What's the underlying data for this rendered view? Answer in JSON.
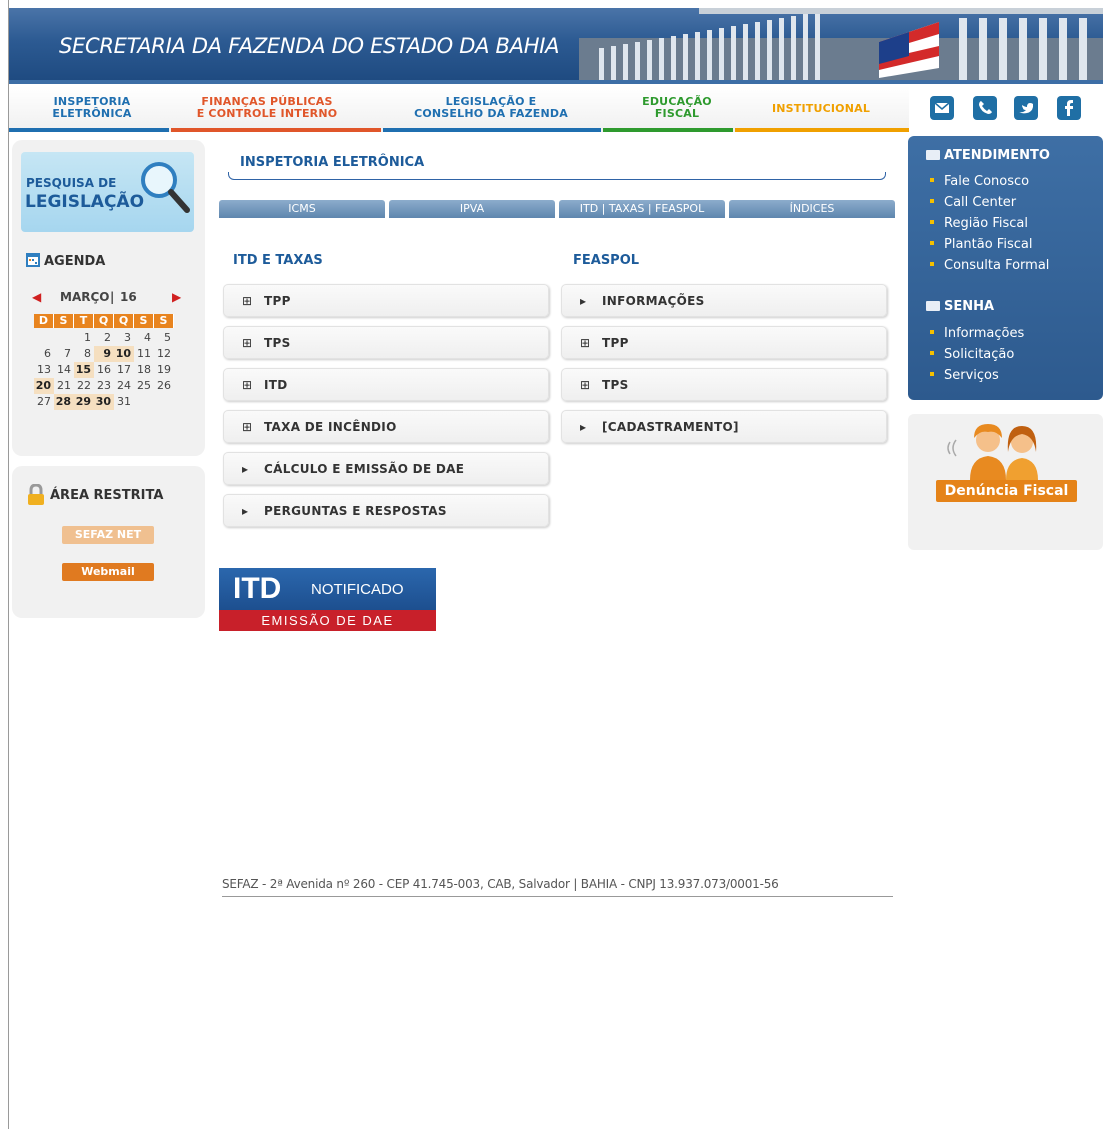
{
  "banner": {
    "title": "SECRETARIA DA FAZENDA DO ESTADO DA BAHIA"
  },
  "topnav": [
    {
      "line1": "INSPETORIA",
      "line2": "ELETRÔNICA",
      "color": "#1f6fb0"
    },
    {
      "line1": "FINANÇAS PÚBLICAS",
      "line2": "E CONTROLE INTERNO",
      "color": "#e0562a"
    },
    {
      "line1": "LEGISLAÇÃO E",
      "line2": "CONSELHO DA FAZENDA",
      "color": "#1f6fb0"
    },
    {
      "line1": "EDUCAÇÃO",
      "line2": "FISCAL",
      "color": "#2e9a2e"
    },
    {
      "line1": "INSTITUCIONAL",
      "line2": "",
      "color": "#f0a000"
    }
  ],
  "social_icons": [
    "email-icon",
    "phone-icon",
    "twitter-icon",
    "facebook-icon"
  ],
  "left": {
    "pesquisa_a": "PESQUISA DE",
    "pesquisa_b": "LEGISLAÇÃO",
    "agenda_title": "AGENDA",
    "calendar": {
      "month": "MARÇO",
      "year": "16",
      "weekdays": [
        "D",
        "S",
        "T",
        "Q",
        "Q",
        "S",
        "S"
      ],
      "days": [
        "",
        "",
        "1",
        "2",
        "3",
        "4",
        "5",
        "6",
        "7",
        "8",
        "9",
        "10",
        "11",
        "12",
        "13",
        "14",
        "15",
        "16",
        "17",
        "18",
        "19",
        "20",
        "21",
        "22",
        "23",
        "24",
        "25",
        "26",
        "27",
        "28",
        "29",
        "30",
        "31",
        "",
        ""
      ],
      "event_days": [
        "9",
        "10",
        "15",
        "20",
        "28",
        "29",
        "30"
      ]
    },
    "restrita_title": "ÁREA RESTRITA",
    "sefaz_net": "SEFAZ NET",
    "webmail": "Webmail"
  },
  "center": {
    "title": "INSPETORIA ELETRÔNICA",
    "tabs": [
      "ICMS",
      "IPVA",
      "ITD | TAXAS | FEASPOL",
      "ÍNDICES"
    ],
    "col1_title": "ITD E TAXAS",
    "col2_title": "FEASPOL",
    "col1_items": [
      {
        "sym": "⊞",
        "label": "TPP"
      },
      {
        "sym": "⊞",
        "label": "TPS"
      },
      {
        "sym": "⊞",
        "label": "ITD"
      },
      {
        "sym": "⊞",
        "label": "TAXA DE INCÊNDIO"
      },
      {
        "sym": "▸",
        "label": "CÁLCULO E EMISSÃO DE DAE"
      },
      {
        "sym": "▸",
        "label": "PERGUNTAS E RESPOSTAS"
      }
    ],
    "col2_items": [
      {
        "sym": "▸",
        "label": "INFORMAÇÕES"
      },
      {
        "sym": "⊞",
        "label": "TPP"
      },
      {
        "sym": "⊞",
        "label": "TPS"
      },
      {
        "sym": "▸",
        "label": "[CADASTRAMENTO]"
      }
    ],
    "itd_banner": {
      "big": "ITD",
      "notificado": "NOTIFICADO",
      "emissao": "EMISSÃO DE DAE"
    },
    "footer": "SEFAZ - 2ª Avenida nº 260 - CEP 41.745-003, CAB, Salvador | BAHIA - CNPJ 13.937.073/0001-56"
  },
  "right": {
    "atendimento_title": "ATENDIMENTO",
    "atendimento_links": [
      "Fale Conosco",
      "Call Center",
      "Região Fiscal",
      "Plantão Fiscal",
      "Consulta Formal"
    ],
    "senha_title": "SENHA",
    "senha_links": [
      "Informações",
      "Solicitação",
      "Serviços"
    ],
    "denuncia": "Denúncia Fiscal"
  }
}
